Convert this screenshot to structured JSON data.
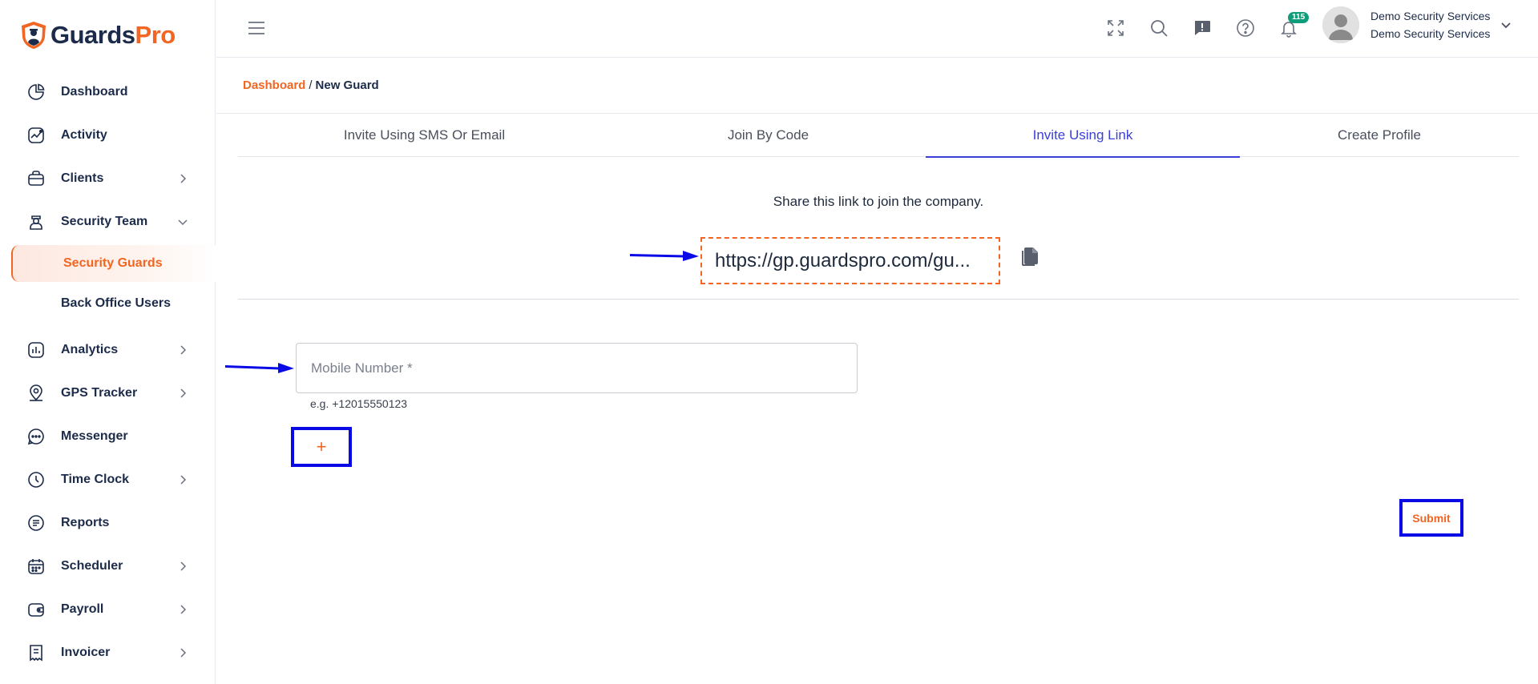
{
  "brand": {
    "name_part1": "Guards",
    "name_part2": "Pro",
    "accent": "#f26522",
    "navy": "#1c2b4a",
    "tab_active": "#3b3fd8",
    "annotation": "#0a0ae6"
  },
  "sidebar": {
    "items": [
      {
        "label": "Dashboard",
        "icon": "pie-chart-icon"
      },
      {
        "label": "Activity",
        "icon": "activity-chart-icon"
      },
      {
        "label": "Clients",
        "icon": "briefcase-icon"
      },
      {
        "label": "Security Team",
        "icon": "guard-icon"
      },
      {
        "label": "Analytics",
        "icon": "bar-chart-icon"
      },
      {
        "label": "GPS Tracker",
        "icon": "map-pin-icon"
      },
      {
        "label": "Messenger",
        "icon": "chat-bubble-icon"
      },
      {
        "label": "Time Clock",
        "icon": "clock-icon"
      },
      {
        "label": "Reports",
        "icon": "report-icon"
      },
      {
        "label": "Scheduler",
        "icon": "calendar-icon"
      },
      {
        "label": "Payroll",
        "icon": "wallet-icon"
      },
      {
        "label": "Invoicer",
        "icon": "invoice-icon"
      }
    ],
    "security_team_sub": [
      {
        "label": "Security Guards"
      },
      {
        "label": "Back Office Users"
      }
    ]
  },
  "topbar": {
    "notifications_count": "115",
    "user_name": "Demo Security Services",
    "user_company": "Demo Security Services"
  },
  "breadcrumb": {
    "root": "Dashboard",
    "separator": "/",
    "current": "New Guard"
  },
  "tabs": [
    {
      "label": "Invite Using SMS Or Email"
    },
    {
      "label": "Join By Code"
    },
    {
      "label": "Invite Using Link"
    },
    {
      "label": "Create Profile"
    }
  ],
  "share": {
    "instruction": "Share this link to join the company.",
    "link": "https://gp.guardspro.com/gu..."
  },
  "form": {
    "mobile_placeholder": "Mobile Number *",
    "mobile_hint": "e.g. +12015550123",
    "add_label": "+",
    "submit_label": "Submit"
  }
}
